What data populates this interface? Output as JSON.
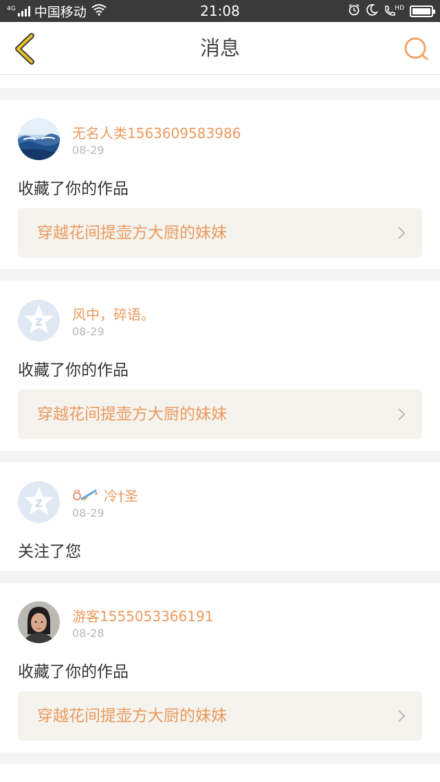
{
  "status_bar": {
    "network": "4G",
    "carrier": "中国移动",
    "time": "21:08",
    "hd": "HD"
  },
  "nav": {
    "title": "消息"
  },
  "colors": {
    "accent": "#ec9a5d",
    "back_icon": "#e7c12a",
    "search_icon": "#f3a46a"
  },
  "messages": [
    {
      "user": "无名人类1563609583986",
      "date": "08-29",
      "action": "收藏了你的作品",
      "work": "穿越花间提壶方大厨的妹妹",
      "avatar": "landscape-photo"
    },
    {
      "user": "风中，碎语。",
      "date": "08-29",
      "action": "收藏了你的作品",
      "work": "穿越花间提壶方大厨的妹妹",
      "avatar": "default-star-avatar"
    },
    {
      "user": "冷†圣",
      "date": "08-29",
      "action": "关注了您",
      "avatar": "default-star-avatar",
      "name_icon": "decorative-emoji-icon"
    },
    {
      "user": "游客1555053366191",
      "date": "08-28",
      "action": "收藏了你的作品",
      "work": "穿越花间提壶方大厨的妹妹",
      "avatar": "person-photo"
    }
  ]
}
